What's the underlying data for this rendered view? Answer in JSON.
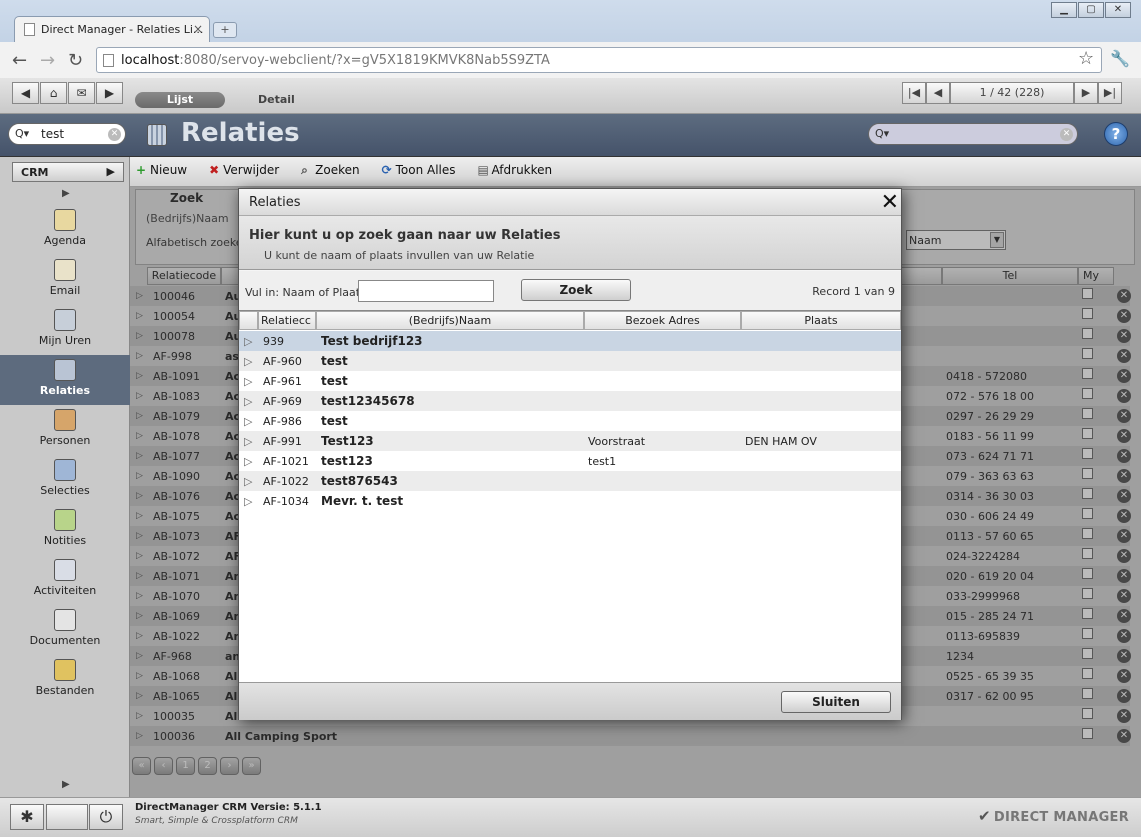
{
  "browser": {
    "tab_title": "Direct Manager - Relaties Li...",
    "tab_close": "×",
    "new_tab": "+",
    "url_host": "localhost",
    "url_rest": ":8080/servoy-webclient/?x=gV5X1819KMVK8Nab5S9ZTA",
    "window_buttons": [
      "▁",
      "▢",
      "✕"
    ],
    "nav": {
      "back": "←",
      "forward": "→",
      "reload": "↻"
    },
    "star": "☆",
    "wrench": "🔧"
  },
  "apptoolbar": {
    "views": [
      "Lijst",
      "Detail"
    ],
    "pager_text": "1 / 42 (228)",
    "icons": {
      "back": "◀",
      "home": "⌂",
      "mail": "✉",
      "forward": "▶",
      "first": "|◀",
      "prev": "◀",
      "next": "▶",
      "last": "▶|"
    }
  },
  "titlebar": {
    "title": "Relaties",
    "search_value": "test",
    "search_icon": "Q▾",
    "help": "?"
  },
  "leftnav": {
    "module": "CRM",
    "module_arrow": "▶",
    "collapse_top": "▶",
    "collapse_bottom": "▶",
    "items": [
      {
        "label": "Agenda",
        "icon": "calendar-icon",
        "color": "#e8d8a0"
      },
      {
        "label": "Email",
        "icon": "envelope-icon",
        "color": "#e9e2c9"
      },
      {
        "label": "Mijn Uren",
        "icon": "stopwatch-icon",
        "color": "#c7cfd9"
      },
      {
        "label": "Relaties",
        "icon": "building-icon",
        "color": "#b9c4d4",
        "selected": true
      },
      {
        "label": "Personen",
        "icon": "people-icon",
        "color": "#d6a56a"
      },
      {
        "label": "Selecties",
        "icon": "magnifier-icon",
        "color": "#9fb6d6"
      },
      {
        "label": "Notities",
        "icon": "note-icon",
        "color": "#b8d48a"
      },
      {
        "label": "Activiteiten",
        "icon": "calendar-check-icon",
        "color": "#d9dde6"
      },
      {
        "label": "Documenten",
        "icon": "document-icon",
        "color": "#e4e4e4"
      },
      {
        "label": "Bestanden",
        "icon": "folder-icon",
        "color": "#e0c260"
      }
    ]
  },
  "actions": [
    {
      "label": "Nieuw",
      "icon": "+",
      "color": "#2e9b2e",
      "name": "plus-icon"
    },
    {
      "label": "Verwijder",
      "icon": "✖",
      "color": "#c02020",
      "name": "delete-icon"
    },
    {
      "label": "Zoeken",
      "icon": "⌕",
      "color": "#555",
      "name": "binoculars-icon"
    },
    {
      "label": "Toon Alles",
      "icon": "⟳",
      "color": "#2b62b0",
      "name": "refresh-icon"
    },
    {
      "label": "Afdrukken",
      "icon": "▤",
      "color": "#555",
      "name": "printer-icon"
    }
  ],
  "zoek": {
    "tab": "Zoek",
    "field1": "(Bedrijfs)Naam",
    "field2": "Alfabetisch zoeken",
    "sort_value": "Naam",
    "sort_arrow": "▼"
  },
  "table": {
    "columns": {
      "code": "Relatiecode",
      "tel": "Tel",
      "my": "My"
    },
    "rows": [
      {
        "code": "100046",
        "name": "Au",
        "tel": ""
      },
      {
        "code": "100054",
        "name": "Au",
        "tel": ""
      },
      {
        "code": "100078",
        "name": "Au",
        "tel": ""
      },
      {
        "code": "AF-998",
        "name": "as",
        "tel": ""
      },
      {
        "code": "AB-1091",
        "name": "Ac",
        "tel": "0418 - 572080"
      },
      {
        "code": "AB-1083",
        "name": "Ac",
        "tel": "072 - 576 18 00"
      },
      {
        "code": "AB-1079",
        "name": "Ac",
        "tel": "0297 - 26 29 29"
      },
      {
        "code": "AB-1078",
        "name": "Ac",
        "tel": "0183 - 56 11 99"
      },
      {
        "code": "AB-1077",
        "name": "Ac",
        "tel": "073 - 624 71 71"
      },
      {
        "code": "AB-1090",
        "name": "Ac",
        "tel": "079 - 363 63 63"
      },
      {
        "code": "AB-1076",
        "name": "Ac",
        "tel": "0314 - 36 30 03"
      },
      {
        "code": "AB-1075",
        "name": "Ac",
        "tel": "030 - 606 24 49"
      },
      {
        "code": "AB-1073",
        "name": "AF",
        "tel": "0113 - 57 60 65"
      },
      {
        "code": "AB-1072",
        "name": "AF",
        "tel": "024-3224284"
      },
      {
        "code": "AB-1071",
        "name": "An",
        "tel": "020 - 619 20 04"
      },
      {
        "code": "AB-1070",
        "name": "An",
        "tel": "033-2999968"
      },
      {
        "code": "AB-1069",
        "name": "An",
        "tel": "015 - 285 24 71"
      },
      {
        "code": "AB-1022",
        "name": "An",
        "tel": "0113-695839"
      },
      {
        "code": "AF-968",
        "name": "an",
        "tel": "1234"
      },
      {
        "code": "AB-1068",
        "name": "All",
        "tel": "0525 - 65 39 35"
      },
      {
        "code": "AB-1065",
        "name": "All",
        "tel": "0317 - 62 00 95"
      },
      {
        "code": "100035",
        "name": "All",
        "tel": ""
      },
      {
        "code": "100036",
        "name": "All Camping Sport",
        "tel": ""
      }
    ],
    "pager": [
      "«",
      "‹",
      "1",
      "2",
      "›",
      "»"
    ]
  },
  "modal": {
    "title": "Relaties",
    "close": "✕",
    "heading": "Hier kunt u op zoek gaan naar uw Relaties",
    "subheading": "U kunt de naam of plaats invullen van uw Relatie",
    "search_label": "Vul in: Naam of Plaats",
    "search_value": "",
    "search_button": "Zoek",
    "record_info": "Record 1 van 9",
    "columns": {
      "code": "Relatiecc",
      "name": "(Bedrijfs)Naam",
      "adres": "Bezoek Adres",
      "plaats": "Plaats"
    },
    "rows": [
      {
        "code": "939",
        "name": "Test bedrijf123",
        "adres": "",
        "plaats": ""
      },
      {
        "code": "AF-960",
        "name": "test",
        "adres": "",
        "plaats": ""
      },
      {
        "code": "AF-961",
        "name": "test",
        "adres": "",
        "plaats": ""
      },
      {
        "code": "AF-969",
        "name": "test12345678",
        "adres": "",
        "plaats": ""
      },
      {
        "code": "AF-986",
        "name": "test",
        "adres": "",
        "plaats": ""
      },
      {
        "code": "AF-991",
        "name": "Test123",
        "adres": "Voorstraat",
        "plaats": "DEN HAM OV"
      },
      {
        "code": "AF-1021",
        "name": "test123",
        "adres": "test1",
        "plaats": ""
      },
      {
        "code": "AF-1022",
        "name": "test876543",
        "adres": "",
        "plaats": ""
      },
      {
        "code": "AF-1034",
        "name": "Mevr. t. test",
        "adres": "",
        "plaats": ""
      }
    ],
    "close_button": "Sluiten"
  },
  "footer": {
    "version": "DirectManager CRM Versie: 5.1.1",
    "slogan": "Smart, Simple & Crossplatform CRM",
    "logo": "DIRECT MANAGER",
    "logo_mark": "✔",
    "left_icon": "✱",
    "power_icon": "⏻"
  }
}
